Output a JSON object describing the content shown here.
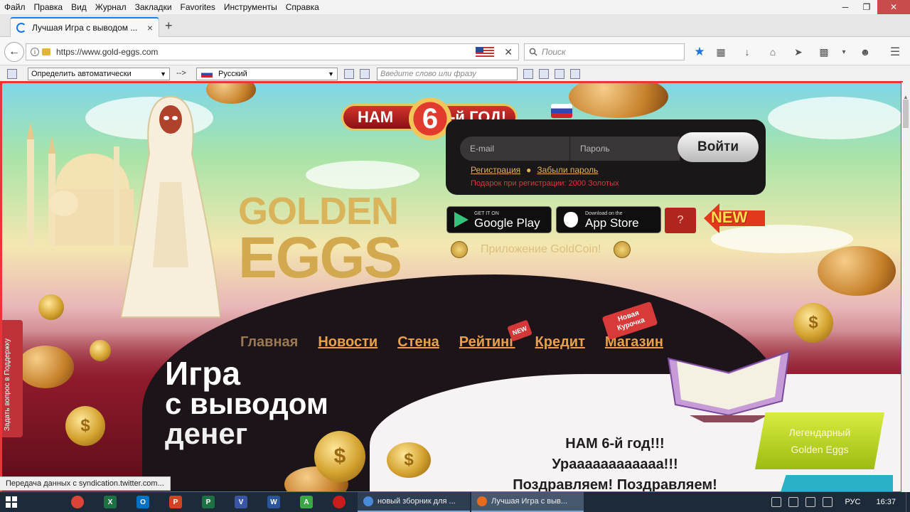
{
  "menubar": {
    "items": [
      "Файл",
      "Правка",
      "Вид",
      "Журнал",
      "Закладки",
      "Favorites",
      "Инструменты",
      "Справка"
    ],
    "minimize": "─",
    "restore": "❐",
    "close": "✕"
  },
  "tabs": {
    "active_title": "Лучшая Игра с выводом ...",
    "close": "×",
    "new_tab": "+"
  },
  "navbar": {
    "url": "https://www.gold-eggs.com",
    "url_info": "i",
    "clear": "✕",
    "search_placeholder": "Поиск",
    "icons": [
      "star-icon",
      "reading-list-icon",
      "download-icon",
      "home-icon",
      "send-icon",
      "extension-icon",
      "avatar-icon",
      "menu-icon"
    ]
  },
  "translate_bar": {
    "source_lang": "Определить автоматически",
    "arrow": "-->",
    "target_lang": "Русский",
    "input_placeholder": "Введите слово или фразу"
  },
  "site": {
    "anniversary_left": "НАМ",
    "anniversary_number": "6",
    "anniversary_right": "-й ГОД!",
    "brand_top": "GOLDEN",
    "brand_bottom": "EGGS",
    "login": {
      "email_placeholder": "E-mail",
      "password_placeholder": "Пароль",
      "submit": "Войти",
      "register": "Регистрация",
      "forgot": "Забыли пароль",
      "gift": "Подарок при регистрации: 2000 Золотых"
    },
    "stores": {
      "google_small": "GET IT ON",
      "google_big": "Google Play",
      "apple_small": "Download on the",
      "apple_big": "App Store"
    },
    "help": "?",
    "new_badge": "NEW",
    "goldcoin_text": "Приложение GoldCoin!",
    "nav": [
      "Главная",
      "Новости",
      "Стена",
      "Рейтинг",
      "Кредит",
      "Магазин"
    ],
    "tag_new": "NEW",
    "tag_kurochka_1": "Новая",
    "tag_kurochka_2": "Курочка",
    "hero": [
      "Игра",
      "с выводом",
      "денег"
    ],
    "congrats": [
      "НАМ 6-й год!!!",
      "Ураааааааааааа!!!",
      "Поздравляем! Поздравляем!"
    ],
    "legend_1": "Легендарный",
    "legend_2": "Golden Eggs",
    "support": "Задать вопрос в Поддержку",
    "coin_symbol": "$"
  },
  "status_bar": {
    "text": "Передача данных с syndication.twitter.com..."
  },
  "taskbar": {
    "windows": [
      {
        "title": "новый зборник для ...",
        "active": false
      },
      {
        "title": "Лучшая Игра с выв...",
        "active": true
      }
    ],
    "lang": "РУС",
    "time": "16:37"
  },
  "colors": {
    "accent_red": "#e8353a",
    "gold": "#d9b45a",
    "nav_link": "#e8a04c"
  }
}
